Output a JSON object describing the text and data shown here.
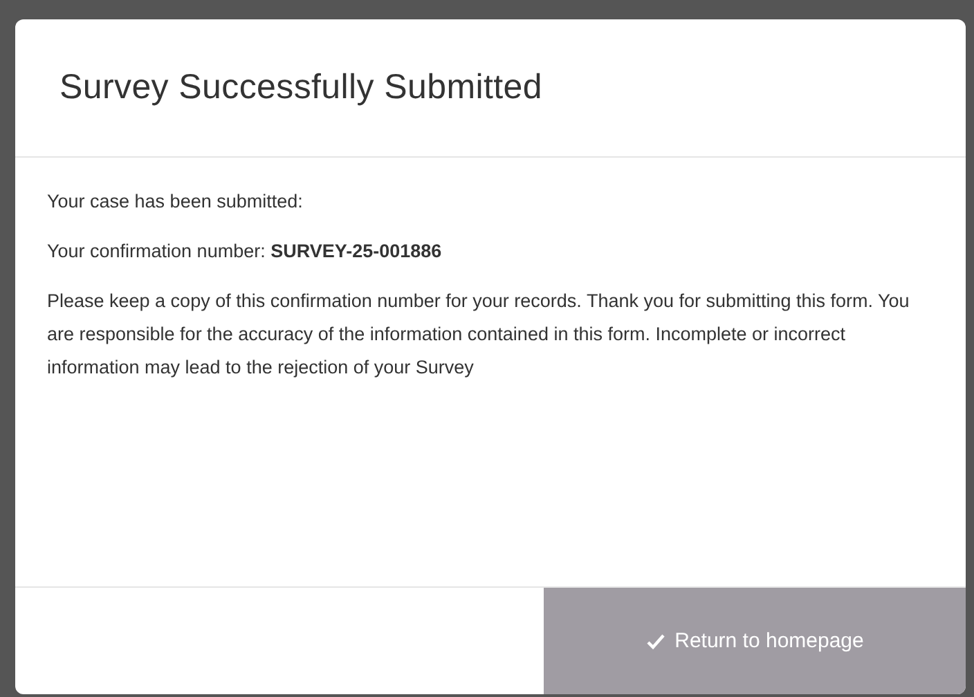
{
  "dialog": {
    "title": "Survey Successfully Submitted",
    "paragraphs": [
      "Your case has been submitted:",
      "Your confirmation number: **SURVEY-25-001886**",
      "Please keep a copy of this confirmation number for your records. Thank you for submitting this form. You are responsible for the accuracy of the information contained in this form. Incomplete or incorrect information may lead to the rejection of your Survey"
    ],
    "button": {
      "label": "Return to homepage"
    }
  }
}
